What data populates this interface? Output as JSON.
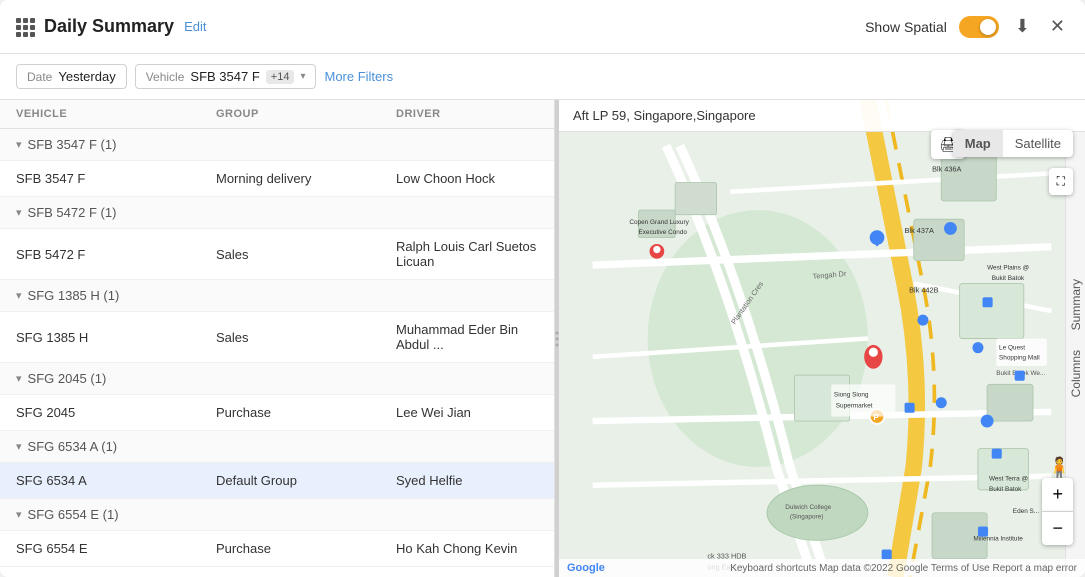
{
  "header": {
    "grid_icon": "grid-icon",
    "title": "Daily Summary",
    "edit_label": "Edit",
    "show_spatial_label": "Show Spatial",
    "toggle_state": true,
    "download_icon": "⬇",
    "close_icon": "✕"
  },
  "filters": {
    "date_label": "Date",
    "date_value": "Yesterday",
    "vehicle_label": "Vehicle",
    "vehicle_value": "SFB 3547 F",
    "vehicle_badge": "+14",
    "more_filters_label": "More Filters"
  },
  "table": {
    "col_vehicle": "VEHICLE",
    "col_group": "GROUP",
    "col_driver": "DRIVER",
    "groups": [
      {
        "id": "g1",
        "title": "SFB 3547 F (1)",
        "rows": [
          {
            "vehicle": "SFB 3547 F",
            "group": "Morning delivery",
            "driver": "Low Choon Hock",
            "highlighted": false
          }
        ]
      },
      {
        "id": "g2",
        "title": "SFB 5472 F (1)",
        "rows": [
          {
            "vehicle": "SFB 5472 F",
            "group": "Sales",
            "driver": "Ralph Louis Carl Suetos Licuan",
            "highlighted": false
          }
        ]
      },
      {
        "id": "g3",
        "title": "SFG 1385 H (1)",
        "rows": [
          {
            "vehicle": "SFG 1385 H",
            "group": "Sales",
            "driver": "Muhammad Eder Bin Abdul ...",
            "highlighted": false
          }
        ]
      },
      {
        "id": "g4",
        "title": "SFG 2045 (1)",
        "rows": [
          {
            "vehicle": "SFG 2045",
            "group": "Purchase",
            "driver": "Lee Wei Jian",
            "highlighted": false
          }
        ]
      },
      {
        "id": "g5",
        "title": "SFG 6534 A (1)",
        "rows": [
          {
            "vehicle": "SFG 6534 A",
            "group": "Default Group",
            "driver": "Syed Helfie",
            "highlighted": true
          }
        ]
      },
      {
        "id": "g6",
        "title": "SFG 6554 E (1)",
        "rows": [
          {
            "vehicle": "SFG 6554 E",
            "group": "Purchase",
            "driver": "Ho Kah Chong Kevin",
            "highlighted": false
          }
        ]
      }
    ]
  },
  "map": {
    "address": "Aft LP 59, Singapore,Singapore",
    "map_btn": "Map",
    "satellite_btn": "Satellite",
    "zoom_in": "+",
    "zoom_out": "−",
    "footer_left": "Google",
    "footer_center": "Map data ©2022 Google",
    "footer_links": "Keyboard shortcuts   Map data ©2022 Google   Terms of Use   Report a map error"
  },
  "right_panel": {
    "tab1": "Summary",
    "tab2": "Columns"
  },
  "colors": {
    "accent": "#4a90d9",
    "toggle_on": "#f5a623",
    "highlight_row": "#e8f0fd",
    "road_yellow": "#f5c842",
    "map_green": "#c8dfc8"
  }
}
